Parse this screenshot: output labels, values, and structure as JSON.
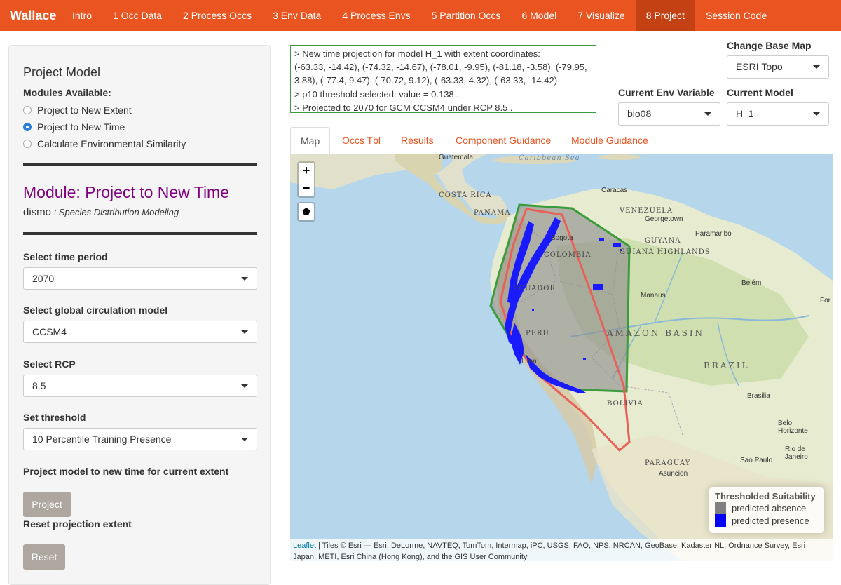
{
  "navbar": {
    "brand": "Wallace",
    "items": [
      "Intro",
      "1 Occ Data",
      "2 Process Occs",
      "3 Env Data",
      "4 Process Envs",
      "5 Partition Occs",
      "6 Model",
      "7 Visualize",
      "8 Project",
      "Session Code"
    ],
    "active_index": 8
  },
  "sidebar": {
    "title": "Project Model",
    "modules_label": "Modules Available:",
    "modules": [
      {
        "label": "Project to New Extent",
        "checked": false
      },
      {
        "label": "Project to New Time",
        "checked": true
      },
      {
        "label": "Calculate Environmental Similarity",
        "checked": false
      }
    ],
    "module_title": "Module: Project to New Time",
    "package_name": "dismo",
    "package_desc": " : Species Distribution Modeling",
    "time_label": "Select time period",
    "time_value": "2070",
    "gcm_label": "Select global circulation model",
    "gcm_value": "CCSM4",
    "rcp_label": "Select RCP",
    "rcp_value": "8.5",
    "threshold_label": "Set threshold",
    "threshold_value": "10 Percentile Training Presence",
    "project_label": "Project model to new time for current extent",
    "project_button": "Project",
    "reset_label": "Reset projection extent",
    "reset_button": "Reset"
  },
  "log": {
    "lines": [
      "> New time projection for model H_1 with extent coordinates:",
      "(-63.33, -14.42), (-74.32, -14.67), (-78.01, -9.95), (-81.18, -3.58), (-79.95,",
      "3.88), (-77.4, 9.47), (-70.72, 9.12), (-63.33, 4.32), (-63.33, -14.42)",
      "> p10 threshold selected: value = 0.138 .",
      "> Projected to 2070 for GCM CCSM4 under RCP 8.5 ."
    ]
  },
  "controls": {
    "base_map_label": "Change Base Map",
    "base_map_value": "ESRI Topo",
    "env_var_label": "Current Env Variable",
    "env_var_value": "bio08",
    "model_label": "Current Model",
    "model_value": "H_1"
  },
  "tabs": [
    "Map",
    "Occs Tbl",
    "Results",
    "Component Guidance",
    "Module Guidance"
  ],
  "map": {
    "zoom_in": "+",
    "zoom_out": "−",
    "draw": "⬟",
    "labels": {
      "guatemala": "Guatemala",
      "caribbean": "Caribbean Sea",
      "costa_rica": "COSTA RICA",
      "panama": "PANAMA",
      "caracas": "Caracas",
      "venezuela": "VENEZUELA",
      "georgetown": "Georgetown",
      "paramaribo": "Paramaribo",
      "guyana": "GUYANA",
      "highlands": "GUIANA HIGHLANDS",
      "bogota": "Bogota",
      "colombia": "COLOMBIA",
      "ecuador": "ECUADOR",
      "manaus": "Manaus",
      "belem": "Belém",
      "fortaleza": "For",
      "amazon": "AMAZON BASIN",
      "peru": "PERU",
      "brazil": "BRAZIL",
      "lima": "Lima",
      "bolivia": "BOLIVIA",
      "brasilia": "Brasilia",
      "belo": "Belo\nHorizonte",
      "paraguay": "PARAGUAY",
      "asuncion": "Asuncion",
      "sao_paulo": "Sao Paulo",
      "rio": "Rio de\nJaneiro"
    },
    "legend": {
      "title": "Thresholded Suitability",
      "items": [
        {
          "label": "predicted absence",
          "color": "#808080"
        },
        {
          "label": "predicted presence",
          "color": "#0000ff"
        }
      ]
    },
    "attribution_link": "Leaflet",
    "attribution_text": " | Tiles © Esri — Esri, DeLorme, NAVTEQ, TomTom, Intermap, iPC, USGS, FAO, NPS, NRCAN, GeoBase, Kadaster NL, Ordnance Survey, Esri Japan, METI, Esri China (Hong Kong), and the GIS User Community"
  },
  "colors": {
    "navbar": "#e95420",
    "navbar_active": "#c34113",
    "module_title": "#800080",
    "extent_green": "#3c9b3c",
    "projection_red": "#e8605a"
  }
}
